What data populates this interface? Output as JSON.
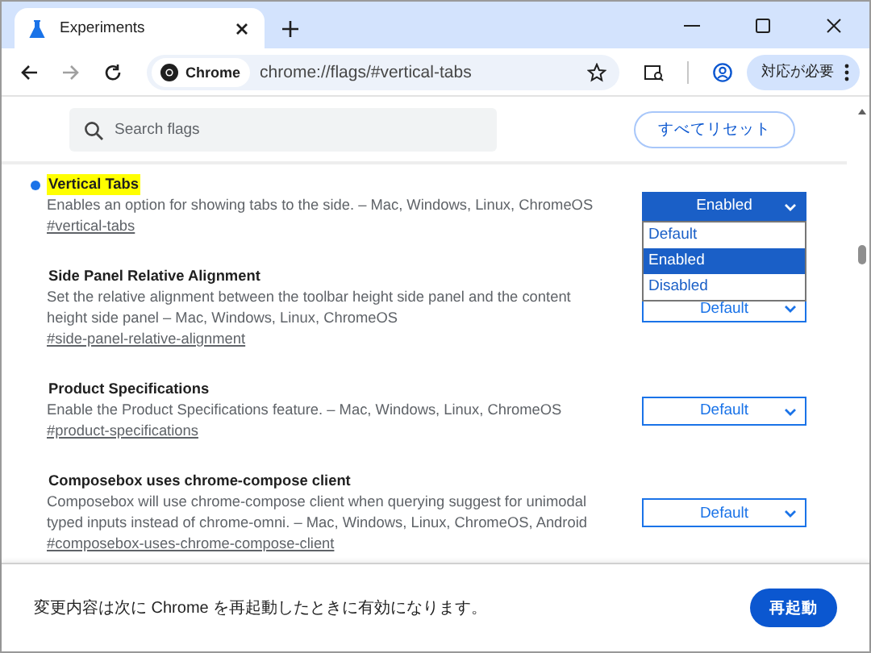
{
  "tab": {
    "title": "Experiments"
  },
  "toolbar": {
    "site_chip": "Chrome",
    "url": "chrome://flags/#vertical-tabs",
    "profile_button": "対応が必要"
  },
  "search": {
    "placeholder": "Search flags"
  },
  "reset_button": "すべてリセット",
  "flags": [
    {
      "title": "Vertical Tabs",
      "highlighted": true,
      "modified": true,
      "description": "Enables an option for showing tabs to the side. – Mac, Windows, Linux, ChromeOS",
      "link": "#vertical-tabs",
      "value": "Enabled",
      "open": true,
      "options": [
        {
          "label": "Default",
          "selected": false
        },
        {
          "label": "Enabled",
          "selected": true
        },
        {
          "label": "Disabled",
          "selected": false
        }
      ]
    },
    {
      "title": "Side Panel Relative Alignment",
      "highlighted": false,
      "modified": false,
      "description": "Set the relative alignment between the toolbar height side panel and the content height side panel – Mac, Windows, Linux, ChromeOS",
      "link": "#side-panel-relative-alignment",
      "value": "Default"
    },
    {
      "title": "Product Specifications",
      "highlighted": false,
      "modified": false,
      "description": "Enable the Product Specifications feature. – Mac, Windows, Linux, ChromeOS",
      "link": "#product-specifications",
      "value": "Default"
    },
    {
      "title": "Composebox uses chrome-compose client",
      "highlighted": false,
      "modified": false,
      "description": "Composebox will use chrome-compose client when querying suggest for unimodal typed inputs instead of chrome-omni. – Mac, Windows, Linux, ChromeOS, Android",
      "link": "#composebox-uses-chrome-compose-client",
      "value": "Default"
    }
  ],
  "footer": {
    "message": "変更内容は次に Chrome を再起動したときに有効になります。",
    "restart_button": "再起動"
  }
}
